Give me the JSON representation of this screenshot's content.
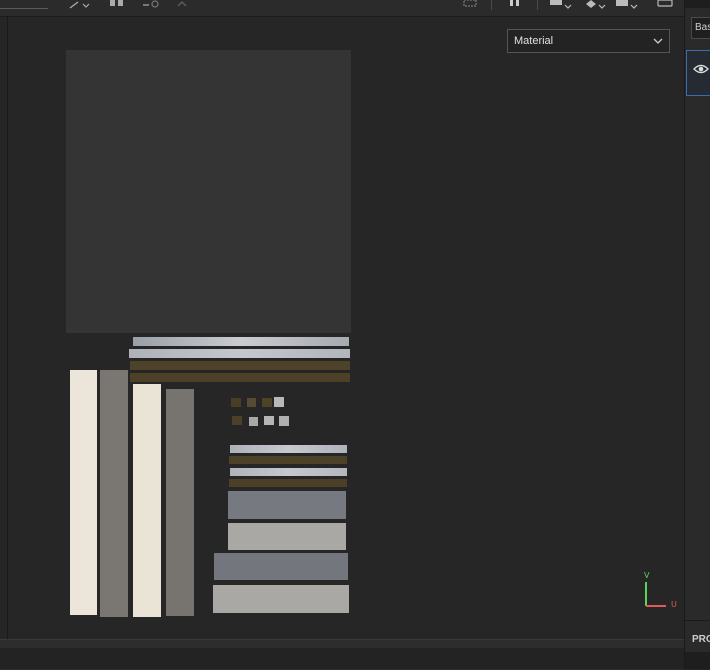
{
  "toolbar": {
    "icons": [
      "selection-mode-icon",
      "mirror-icon",
      "snap-icon",
      "transform-icon",
      "screenshot-icon",
      "pause-icon",
      "camera-icon",
      "view-cube-icon",
      "display-settings-icon",
      "capture-icon"
    ]
  },
  "viewport": {
    "channel_dropdown": {
      "selected": "Material"
    },
    "axis": {
      "v_label": "V",
      "u_label": "U",
      "u_color": "#e05a5a",
      "v_color": "#5ad35a"
    }
  },
  "right_panel": {
    "field_value": "Bas",
    "layer_visibility_icon": "eye-icon",
    "section_label": "PRO"
  }
}
